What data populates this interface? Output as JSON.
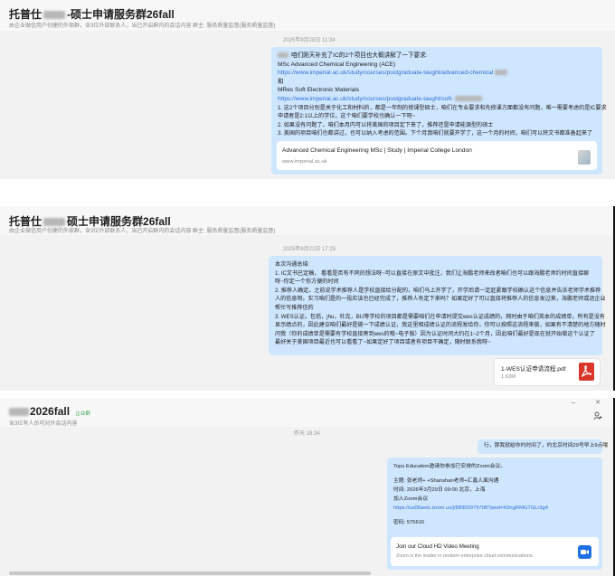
{
  "panel1": {
    "title_prefix": "托普仕",
    "title_suffix": "-硕士申请服务群26fall",
    "subtitle": "由企业微信用户创建的外部群，含3位外部联系人，当已开启群内的会话内容   群主: 服务质量监督(服务质量监督)",
    "timestamp": "2025年8月28日 11:34",
    "message": {
      "l1": "咱们刚天补充了IC的2个项目也大概讲解了一下要求:",
      "l2": "MSc Advanced Chemical Engineering (ACE)",
      "l3": "https://www.imperial.ac.uk/study/courses/postgraduate-taught/advanced-chemical",
      "l4": "和",
      "l5": "MRes Soft Electronic Materials",
      "l6": "https://www.imperial.ac.uk/study/courses/postgraduate-taught/soft-",
      "l7": "1. 这2个项目分别是关于化工和材料的，都是一年制的授课型硕士，咱们在专业要求和先修课方面都没有问题，唯一需要考虑的是IC要求",
      "l8": "申请者是2:1以上的学位，这个咱们要学校也确认一下呀~",
      "l9": "2. 如果没有问题了，咱们本月内可以将美国的项目定下来了，推荐还是申请能源型的硕士",
      "l10": "3. 美国的项目咱们也都讲过，也可以纳入考虑的范围。下个月我咱们就要开学了，这一个月的时间，咱们可以将文书都准备起来了"
    },
    "card": {
      "title": "Advanced Chemical Engineering MSc | Study | Imperial College London",
      "url": "www.imperial.ac.uk"
    }
  },
  "panel2": {
    "title_prefix": "托普仕",
    "title_suffix": "硕士申请服务群26fall",
    "subtitle": "由企业微信用户创建的外部群，含3位外部联系人，当已开启群内的会话内容   群主: 服务质量监督(服务质量监督)",
    "timestamp": "2025年8月22日 17:25",
    "message": {
      "l1": "本次沟通总结:",
      "l2": "1. IC文书已定稿，    看看是否有不同的想法呀~可以直接在原文中批注，我们让海鹏老师来改者咱们也可以跟海鹏老师约时间直接聊",
      "l3": "呀~你定一个你方便的时间",
      "l4": "2. 推荐人确定。之前说学术推荐人是学校直接给分配的，咱们马上开学了，开学后请一定赶紧跟学校确认这个信息并告诉老师学术推荐",
      "l5": "人的信息呀。实习咱们是的一段应该也已经完成了，推荐人有定下来吗？如果定好了可以直接将推荐人的信息发过来，海鹏老师或运企业",
      "l6": "帮忙写推荐信的",
      "l7": "3. WES认证。包括，jhu，杜克，BU等学校的项目都是需要咱们在申请时提交wes认证成绩的，网时由于咱们英本的成绩单，所有是没有",
      "l8": "显示绩点的，因此建议咱们最好是做一下成绩认证，我这里相成绩认证的流程发给你，你可以按照这流程来做，如果有不清楚的地方随时",
      "l9": "问我（你的成绩单是需要有学校直接寄到wes的哦~电子版）因为认证时间大约在1~2个月，因此咱们最好是现在就开始做这个认证了",
      "l10": "最好关于美国项目最近也可以看看了~如果定好了项目或者有项目不确定，随时联系我呀~"
    },
    "file": {
      "name": "1-WES认证申请流程.pdf",
      "size": "1.63M"
    }
  },
  "panel3": {
    "title": "2026fall",
    "badge": "企业群",
    "subtitle": "含3位有人员可对外会话内容",
    "timestamp": "昨天 18:34",
    "win_minimize": "–",
    "win_close": "✕",
    "msg_short": "行，那我就给你约时间了，约北京时间29号早上9点哦",
    "meeting": {
      "l1": "Tops Education邀请你参加已安排的Zoom会议。",
      "l2": "主题: 张老师+     +Shanshan老师+汇鑫人面沟通",
      "l3": "时间: 2026年3月29日 09:00 北京，上海",
      "l4": "加入Zoom会议",
      "l5": "https://us06web.zoom.us/j/88905979708?pwd=K0ngRMG7GLr3g4",
      "l6": "密码: 575616"
    },
    "zoom_card": {
      "title": "Join our Cloud HD Video Meeting",
      "desc": "Zoom is the leader in modern enterprise cloud communications."
    }
  }
}
